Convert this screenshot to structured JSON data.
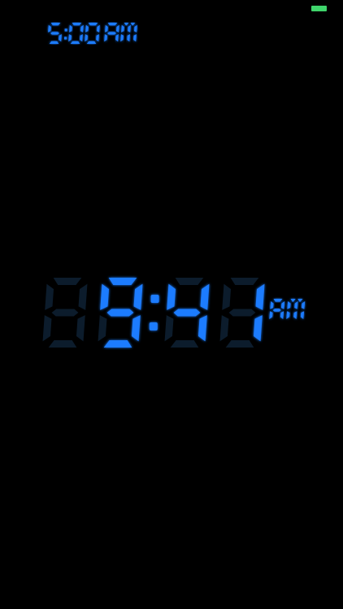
{
  "status_bar": {
    "battery_color": "#3fd46b"
  },
  "alarm": {
    "time": "5:00 AM",
    "digits": [
      "5",
      "0",
      "0"
    ],
    "meridiem": "AM"
  },
  "clock": {
    "time": "9:41 AM",
    "hour_tens": "",
    "hour_ones": "9",
    "minute_tens": "4",
    "minute_ones": "1",
    "meridiem": "AM"
  },
  "colors": {
    "background": "#000000",
    "digit_on": "#1e7cff",
    "digit_off": "#0c1c2c",
    "glow": "#2f8bff"
  }
}
